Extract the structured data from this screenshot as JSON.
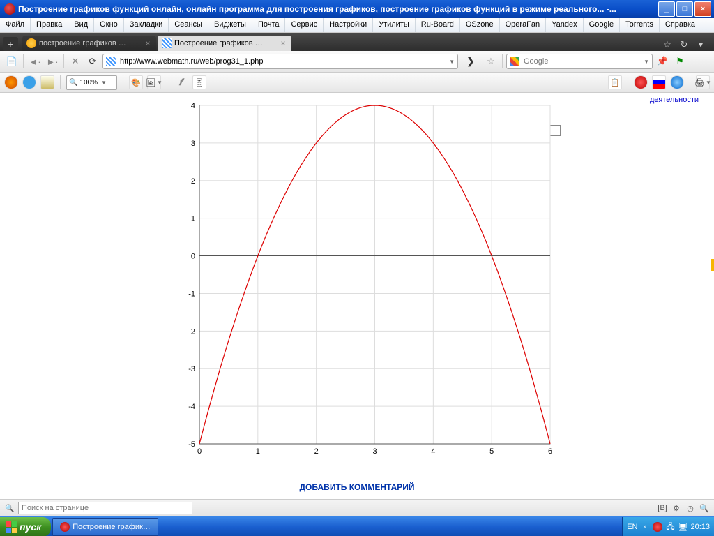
{
  "window": {
    "title": "Построение графиков функций онлайн, онлайн программа для построения графиков, построение графиков функций в режиме реального... -..."
  },
  "menu": [
    "Файл",
    "Правка",
    "Вид",
    "Окно",
    "Закладки",
    "Сеансы",
    "Виджеты",
    "Почта",
    "Сервис",
    "Настройки",
    "Утилиты",
    "Ru-Board",
    "OSzone",
    "OperaFan",
    "Yandex",
    "Google",
    "Torrents",
    "Справка"
  ],
  "tabs": {
    "t1": "построение графиков …",
    "t2": "Построение графиков …"
  },
  "url": "http://www.webmath.ru/web/prog31_1.php",
  "search": {
    "placeholder": "Google"
  },
  "zoom": "100%",
  "page": {
    "rightlink": "деятельности",
    "addcomment": "ДОБАВИТЬ КОММЕНТАРИЙ",
    "x_ticks": [
      "0",
      "1",
      "2",
      "3",
      "4",
      "5",
      "6"
    ],
    "y_ticks": [
      "-5",
      "-4",
      "-3",
      "-2",
      "-1",
      "0",
      "1",
      "2",
      "3",
      "4"
    ]
  },
  "findbar": {
    "placeholder": "Поиск на странице"
  },
  "statusbar": {
    "lang": "[B]"
  },
  "taskbar": {
    "start": "пуск",
    "app": "Построение график…",
    "lang": "EN",
    "clock": "20:13"
  },
  "chart_data": {
    "type": "line",
    "function": "y = 4 - (x-3)^2",
    "x": [
      0.0,
      0.3,
      0.6,
      0.9,
      1.2,
      1.5,
      1.8,
      2.1,
      2.4,
      2.7,
      3.0,
      3.3,
      3.6,
      3.9,
      4.2,
      4.5,
      4.8,
      5.1,
      5.4,
      5.7,
      6.0
    ],
    "y": [
      -5.0,
      -3.29,
      -1.76,
      -0.41,
      0.76,
      1.75,
      2.56,
      3.19,
      3.64,
      3.91,
      4.0,
      3.91,
      3.64,
      3.19,
      2.56,
      1.75,
      0.76,
      -0.41,
      -1.76,
      -3.29,
      -5.0
    ],
    "xlim": [
      0,
      6
    ],
    "ylim": [
      -5,
      4
    ],
    "xlabel": "",
    "ylabel": "",
    "title": ""
  }
}
